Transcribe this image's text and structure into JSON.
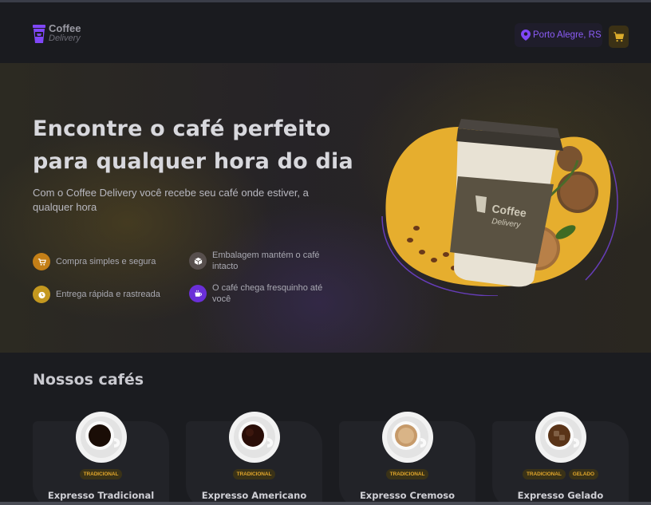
{
  "header": {
    "logo_line1": "Coffee",
    "logo_line2": "Delivery",
    "location": "Porto Alegre, RS"
  },
  "hero": {
    "title": "Encontre o café perfeito para qualquer hora do dia",
    "subtitle": "Com o Coffee Delivery você recebe seu café onde estiver, a qualquer hora",
    "features": [
      {
        "label": "Compra simples e segura",
        "icon": "cart-icon",
        "color": "#c47f17"
      },
      {
        "label": "Embalagem mantém o café intacto",
        "icon": "package-icon",
        "color": "#574f4d"
      },
      {
        "label": "Entrega rápida e rastreada",
        "icon": "timer-icon",
        "color": "#dbac2c"
      },
      {
        "label": "O café chega fresquinho até você",
        "icon": "coffee-icon",
        "color": "#8047f8"
      }
    ],
    "image_logo_line1": "Coffee",
    "image_logo_line2": "Delivery"
  },
  "catalog": {
    "title": "Nossos cafés",
    "coffees": [
      {
        "name": "Expresso Tradicional",
        "tags": [
          "TRADICIONAL"
        ]
      },
      {
        "name": "Expresso Americano",
        "tags": [
          "TRADICIONAL"
        ]
      },
      {
        "name": "Expresso Cremoso",
        "tags": [
          "TRADICIONAL"
        ]
      },
      {
        "name": "Expresso Gelado",
        "tags": [
          "TRADICIONAL",
          "GELADO"
        ]
      }
    ]
  },
  "colors": {
    "accent_purple": "#8047f8",
    "accent_yellow": "#dbac2c",
    "yellow_dark": "#c47f17",
    "background": "#1b1c20"
  }
}
